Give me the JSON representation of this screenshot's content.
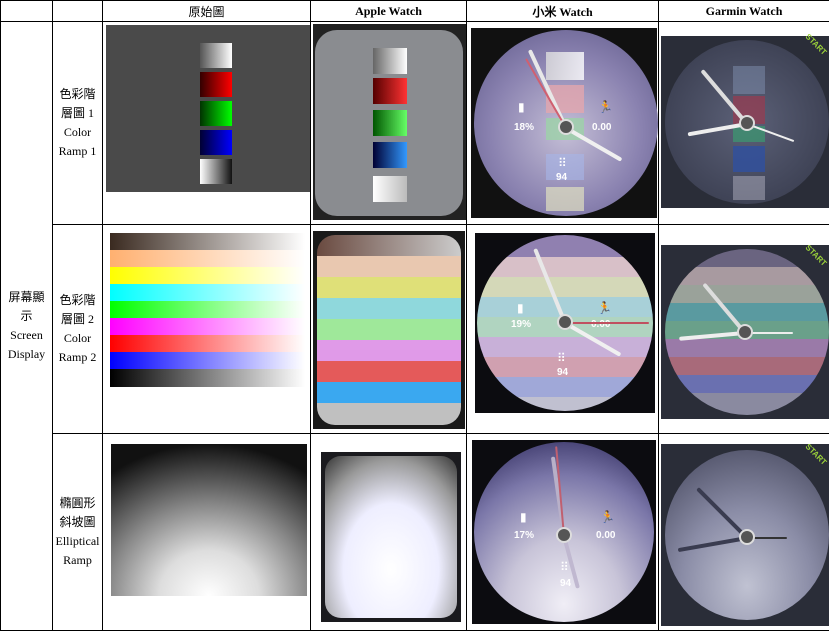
{
  "headers": {
    "original": "原始圖",
    "apple": "Apple Watch",
    "xiaomi": "小米 Watch",
    "garmin": "Garmin Watch"
  },
  "group_label": [
    "屏幕顯",
    "示",
    "Screen",
    "Display"
  ],
  "rows": [
    {
      "label": [
        "色彩階",
        "層圖 1",
        "Color",
        "Ramp 1"
      ]
    },
    {
      "label": [
        "色彩階",
        "層圖 2",
        "Color",
        "Ramp 2"
      ]
    },
    {
      "label": [
        "橢圓形",
        "斜坡圖",
        "Elliptical",
        "Ramp"
      ]
    }
  ],
  "xiaomi_readouts": [
    {
      "battery": "18%",
      "steps_val": "0.00",
      "foot": "94"
    },
    {
      "battery": "19%",
      "steps_val": "0.00",
      "foot": "94"
    },
    {
      "battery": "17%",
      "steps_val": "0.00",
      "foot": "94"
    }
  ],
  "garmin_badge": "START"
}
